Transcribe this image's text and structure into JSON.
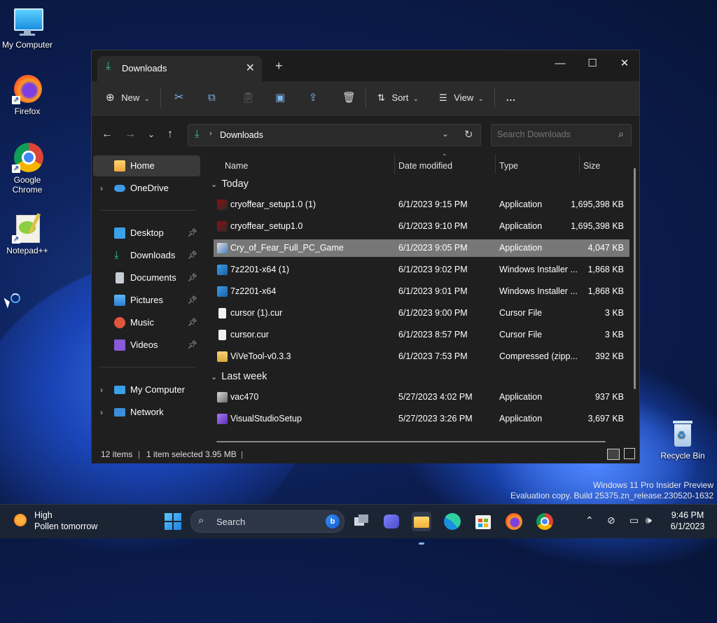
{
  "desktop": {
    "icons": [
      {
        "label": "My Computer",
        "icon": "monitor-icon"
      },
      {
        "label": "Firefox",
        "icon": "firefox-icon"
      },
      {
        "label": "Google Chrome",
        "icon": "chrome-icon"
      },
      {
        "label": "Notepad++",
        "icon": "notepad-plus-plus-icon"
      },
      {
        "label": "Recycle Bin",
        "icon": "recycle-bin-icon"
      }
    ],
    "watermark": {
      "line1": "Windows 11 Pro Insider Preview",
      "line2": "Evaluation copy. Build 25375.zn_release.230520-1632"
    }
  },
  "explorer": {
    "tab_title": "Downloads",
    "new_tab": "+",
    "toolbar": {
      "new_label": "New",
      "sort_label": "Sort",
      "view_label": "View",
      "more_label": "..."
    },
    "address": {
      "current": "Downloads"
    },
    "search": {
      "placeholder": "Search Downloads"
    },
    "nav": {
      "home": "Home",
      "onedrive": "OneDrive",
      "desktop": "Desktop",
      "downloads": "Downloads",
      "documents": "Documents",
      "pictures": "Pictures",
      "music": "Music",
      "videos": "Videos",
      "mycomputer": "My Computer",
      "network": "Network"
    },
    "columns": {
      "name": "Name",
      "date": "Date modified",
      "type": "Type",
      "size": "Size"
    },
    "groups": {
      "today": "Today",
      "lastweek": "Last week"
    },
    "files": [
      {
        "name": "cryoffear_setup1.0 (1)",
        "date": "6/1/2023 9:15 PM",
        "type": "Application",
        "size": "1,695,398 KB"
      },
      {
        "name": "cryoffear_setup1.0",
        "date": "6/1/2023 9:10 PM",
        "type": "Application",
        "size": "1,695,398 KB"
      },
      {
        "name": "Cry_of_Fear_Full_PC_Game",
        "date": "6/1/2023 9:05 PM",
        "type": "Application",
        "size": "4,047 KB"
      },
      {
        "name": "7z2201-x64 (1)",
        "date": "6/1/2023 9:02 PM",
        "type": "Windows Installer ...",
        "size": "1,868 KB"
      },
      {
        "name": "7z2201-x64",
        "date": "6/1/2023 9:01 PM",
        "type": "Windows Installer ...",
        "size": "1,868 KB"
      },
      {
        "name": "cursor (1).cur",
        "date": "6/1/2023 9:00 PM",
        "type": "Cursor File",
        "size": "3 KB"
      },
      {
        "name": "cursor.cur",
        "date": "6/1/2023 8:57 PM",
        "type": "Cursor File",
        "size": "3 KB"
      },
      {
        "name": "ViVeTool-v0.3.3",
        "date": "6/1/2023 7:53 PM",
        "type": "Compressed (zipp...",
        "size": "392 KB"
      },
      {
        "name": "vac470",
        "date": "5/27/2023 4:02 PM",
        "type": "Application",
        "size": "937 KB"
      },
      {
        "name": "VisualStudioSetup",
        "date": "5/27/2023 3:26 PM",
        "type": "Application",
        "size": "3,697 KB"
      }
    ],
    "status": {
      "items": "12 items",
      "selected": "1 item selected  3.95 MB"
    }
  },
  "taskbar": {
    "weather_title": "High",
    "weather_sub": "Pollen tomorrow",
    "search_label": "Search",
    "time": "9:46 PM",
    "date": "6/1/2023"
  },
  "colors": {
    "accent": "#0078d4",
    "selection": "#777777",
    "window_bg": "#202020"
  }
}
